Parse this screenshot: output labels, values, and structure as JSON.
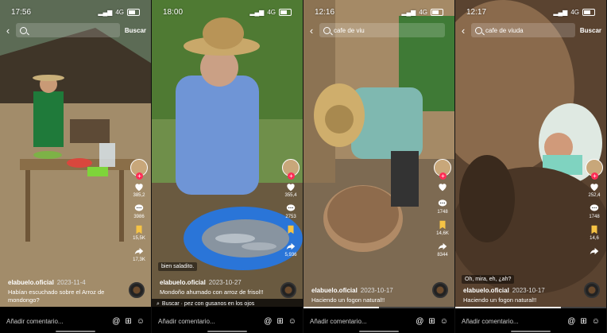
{
  "panels": [
    {
      "time": "17:56",
      "network": "4G",
      "search_text": "",
      "buscar": "Buscar",
      "counts": {
        "likes": "385,2",
        "comments": "3986",
        "saves": "15,5K",
        "shares": "17,3K"
      },
      "username": "elabuelo.oficial",
      "date": "2023-11-4",
      "caption": "Habían escuchado sobre el Arroz de mondongo?",
      "tag": "",
      "search_suggestion": "",
      "progress": 0,
      "comment_placeholder": "Añadir comentario..."
    },
    {
      "time": "18:00",
      "network": "4G",
      "search_text": "",
      "buscar": "",
      "counts": {
        "likes": "355,4",
        "comments": "2753",
        "saves": "",
        "shares": "5,936"
      },
      "username": "elabuelo.oficial",
      "date": "2023-10-27",
      "caption": "Mondoño ahumado con arroz de frisol!!",
      "tag": "bien saladito.",
      "search_suggestion": "Buscar · pez con gusanos en los ojos",
      "progress": 0,
      "comment_placeholder": "Añadir comentario..."
    },
    {
      "time": "12:16",
      "network": "4G",
      "search_text": "cafe de viu",
      "buscar": "",
      "counts": {
        "likes": "",
        "comments": "1748",
        "saves": "14,6K",
        "shares": "8344"
      },
      "username": "elabuelo.oficial",
      "date": "2023-10-17",
      "caption": "Haciendo un fogon natural!!",
      "tag": "",
      "search_suggestion": "",
      "progress": 0.5,
      "comment_placeholder": "Añadir comentario..."
    },
    {
      "time": "12:17",
      "network": "4G",
      "search_text": "cafe de viuda",
      "buscar": "Buscar",
      "counts": {
        "likes": "252,4",
        "comments": "1748",
        "saves": "14,6",
        "shares": ""
      },
      "username": "elabuelo.oficial",
      "date": "2023-10-17",
      "caption": "Haciendo un fogon natural!!",
      "tag": "Oh, mira, eh, ¿ah?",
      "search_suggestion": "",
      "progress": 0.7,
      "comment_placeholder": "Añadir comentario..."
    }
  ],
  "icons": {
    "like": "heart-icon",
    "comment": "comment-icon",
    "save": "bookmark-icon",
    "share": "share-icon",
    "mention": "at-icon",
    "gift": "gift-icon",
    "emoji": "emoji-icon"
  },
  "colors": {
    "accent": "#fe2c55",
    "save": "#f6c344"
  }
}
